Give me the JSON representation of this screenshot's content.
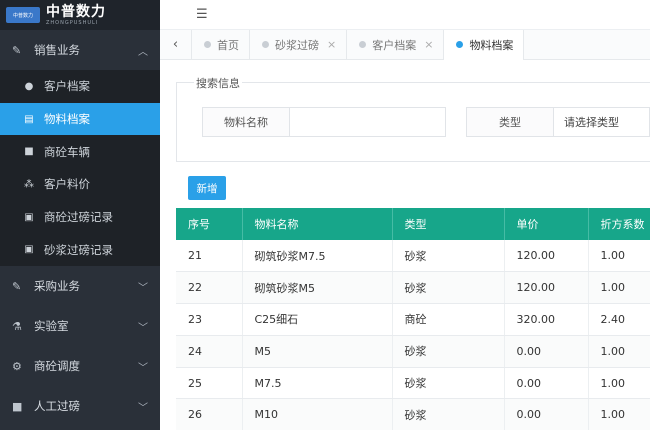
{
  "logo": {
    "badge": "中普数力",
    "name_cn": "中普数力",
    "name_en": "ZHONGPUSHULI"
  },
  "sidebar": {
    "groups": [
      {
        "label": "销售业务",
        "icon": "edit-icon",
        "expanded": true,
        "items": [
          {
            "label": "客户档案",
            "icon": "user-icon"
          },
          {
            "label": "物料档案",
            "icon": "list-icon",
            "active": true
          },
          {
            "label": "商砼车辆",
            "icon": "truck-icon"
          },
          {
            "label": "客户料价",
            "icon": "sitemap-icon"
          },
          {
            "label": "商砼过磅记录",
            "icon": "clipboard-icon"
          },
          {
            "label": "砂浆过磅记录",
            "icon": "clipboard-icon"
          }
        ]
      },
      {
        "label": "采购业务",
        "icon": "edit-icon",
        "expanded": false
      },
      {
        "label": "实验室",
        "icon": "flask-icon",
        "expanded": false
      },
      {
        "label": "商砼调度",
        "icon": "cogs-icon",
        "expanded": false
      },
      {
        "label": "人工过磅",
        "icon": "truck-icon",
        "expanded": false
      }
    ]
  },
  "tabs": [
    {
      "label": "首页",
      "closable": false,
      "active": false
    },
    {
      "label": "砂浆过磅",
      "closable": true,
      "active": false
    },
    {
      "label": "客户档案",
      "closable": true,
      "active": false
    },
    {
      "label": "物料档案",
      "closable": false,
      "active": true
    }
  ],
  "search": {
    "legend": "搜索信息",
    "name_label": "物料名称",
    "name_value": "",
    "type_label": "类型",
    "type_selected": "请选择类型"
  },
  "toolbar": {
    "new_label": "新增"
  },
  "table": {
    "columns": [
      "序号",
      "物料名称",
      "类型",
      "单价",
      "折方系数"
    ],
    "rows": [
      [
        "21",
        "砌筑砂浆M7.5",
        "砂浆",
        "120.00",
        "1.00"
      ],
      [
        "22",
        "砌筑砂浆M5",
        "砂浆",
        "120.00",
        "1.00"
      ],
      [
        "23",
        "C25细石",
        "商砼",
        "320.00",
        "2.40"
      ],
      [
        "24",
        "M5",
        "砂浆",
        "0.00",
        "1.00"
      ],
      [
        "25",
        "M7.5",
        "砂浆",
        "0.00",
        "1.00"
      ],
      [
        "26",
        "M10",
        "砂浆",
        "0.00",
        "1.00"
      ]
    ]
  },
  "colors": {
    "accent": "#2aa0e8",
    "table_header": "#17a68a",
    "sidebar_bg": "#2a3039"
  }
}
